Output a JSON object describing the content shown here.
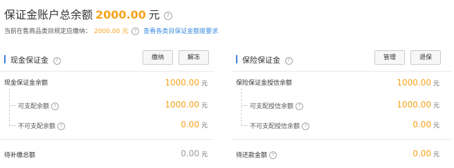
{
  "header": {
    "title": "保证金账户总余额",
    "amount": "2000.00",
    "unit": "元"
  },
  "subline": {
    "label": "当前在售商品类目规定应缴纳：",
    "value": "2000.00",
    "unit": "元",
    "link": "查看各类目保证金额度要求"
  },
  "cash_panel": {
    "title": "现金保证金",
    "buttons": {
      "pay": "缴纳",
      "release": "解冻"
    },
    "rows": {
      "balance": {
        "label": "现金保证金余额",
        "value": "1000.00",
        "unit": "元"
      },
      "available": {
        "label": "可支配余额",
        "value": "1000.00",
        "unit": "元"
      },
      "unavailable": {
        "label": "不可支配余额",
        "value": "0.00",
        "unit": "元"
      },
      "pending": {
        "label": "待补缴总额",
        "value": "0.00",
        "unit": "元"
      }
    }
  },
  "insurance_panel": {
    "title": "保险保证金",
    "buttons": {
      "manage": "管理",
      "refund": "退保"
    },
    "rows": {
      "balance": {
        "label": "保险保证金授信余额",
        "value": "1000.00",
        "unit": "元"
      },
      "available": {
        "label": "可支配授信余额",
        "value": "1000.00",
        "unit": "元"
      },
      "unavailable": {
        "label": "不可支配授信余额",
        "value": "0.00",
        "unit": "元"
      },
      "repay": {
        "label": "待还款金额",
        "value": "0.00",
        "unit": "元"
      }
    }
  },
  "colors": {
    "accent_orange": "#f7a21a",
    "link_blue": "#3b8de0",
    "section_bar": "#3b7fd6",
    "muted_value": "#9b9b9b"
  },
  "icons": {
    "help": "question-circle-icon"
  }
}
